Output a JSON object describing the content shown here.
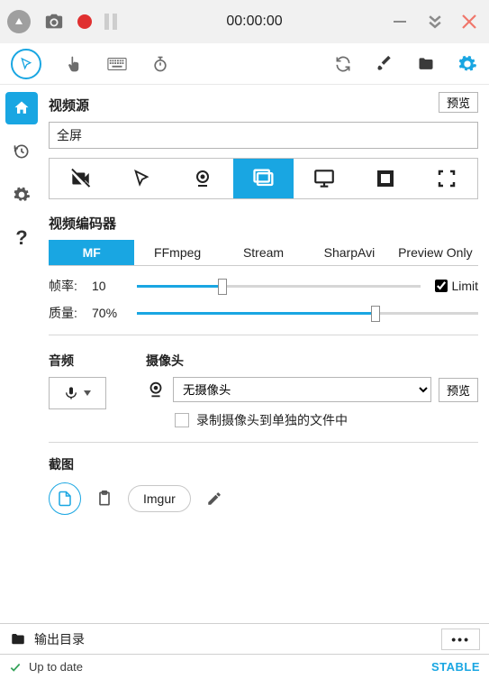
{
  "titlebar": {
    "elapsed": "00:00:00"
  },
  "video_source": {
    "heading": "视频源",
    "preview_btn": "预览",
    "selected": "全屏"
  },
  "encoder": {
    "heading": "视频编码器",
    "tabs": [
      "MF",
      "FFmpeg",
      "Stream",
      "SharpAvi",
      "Preview Only"
    ],
    "active": 0,
    "framerate_label": "帧率:",
    "framerate_value": "10",
    "limit_label": "Limit",
    "quality_label": "质量:",
    "quality_value": "70%"
  },
  "audio": {
    "heading": "音频"
  },
  "camera": {
    "heading": "摄像头",
    "selected": "无摄像头",
    "preview_btn": "预览",
    "record_separate": "录制摄像头到单独的文件中"
  },
  "screenshot": {
    "heading": "截图",
    "imgur": "Imgur"
  },
  "output": {
    "label": "输出目录"
  },
  "status": {
    "text": "Up to date",
    "channel": "STABLE"
  }
}
